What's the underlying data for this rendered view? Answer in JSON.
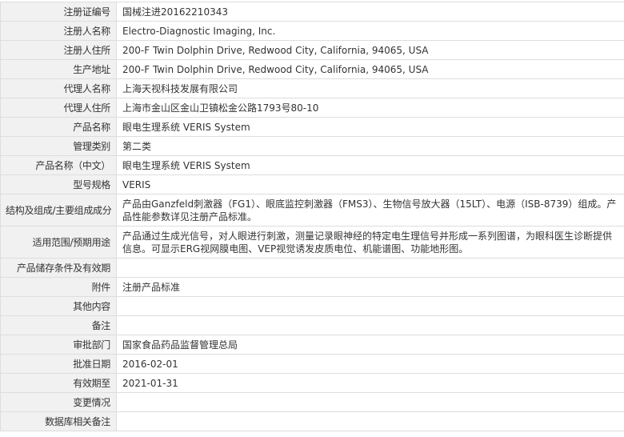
{
  "rows": [
    {
      "label": "注册证编号",
      "value": "国械注进20162210343"
    },
    {
      "label": "注册人名称",
      "value": "Electro-Diagnostic Imaging, Inc."
    },
    {
      "label": "注册人住所",
      "value": "200-F Twin Dolphin Drive, Redwood City, California, 94065, USA"
    },
    {
      "label": "生产地址",
      "value": "200-F Twin Dolphin Drive, Redwood City, California, 94065, USA"
    },
    {
      "label": "代理人名称",
      "value": "上海天视科技发展有限公司"
    },
    {
      "label": "代理人住所",
      "value": "上海市金山区金山卫镇松金公路1793号80-10"
    },
    {
      "label": "产品名称",
      "value": "眼电生理系统 VERIS System"
    },
    {
      "label": "管理类别",
      "value": "第二类"
    },
    {
      "label": "产品名称（中文）",
      "value": "眼电生理系统 VERIS System"
    },
    {
      "label": "型号规格",
      "value": "VERIS"
    },
    {
      "label": "结构及组成/主要组成成分",
      "value": "产品由Ganzfeld刺激器（FG1）、眼底监控刺激器（FMS3）、生物信号放大器（15LT）、电源（ISB-8739）组成。产品性能参数详见注册产品标准。"
    },
    {
      "label": "适用范围/预期用途",
      "value": "产品通过生成光信号，对人眼进行刺激，测量记录眼神经的特定电生理信号并形成一系列图谱，为眼科医生诊断提供信息。可显示ERG视网膜电图、VEP视觉诱发皮质电位、机能谱图、功能地形图。"
    },
    {
      "label": "产品储存条件及有效期",
      "value": ""
    },
    {
      "label": "附件",
      "value": "注册产品标准"
    },
    {
      "label": "其他内容",
      "value": ""
    },
    {
      "label": "备注",
      "value": ""
    },
    {
      "label": "审批部门",
      "value": "国家食品药品监督管理总局"
    },
    {
      "label": "批准日期",
      "value": "2016-02-01"
    },
    {
      "label": "有效期至",
      "value": "2021-01-31"
    },
    {
      "label": "变更情况",
      "value": ""
    },
    {
      "label": "数据库相关备注",
      "value": ""
    }
  ]
}
